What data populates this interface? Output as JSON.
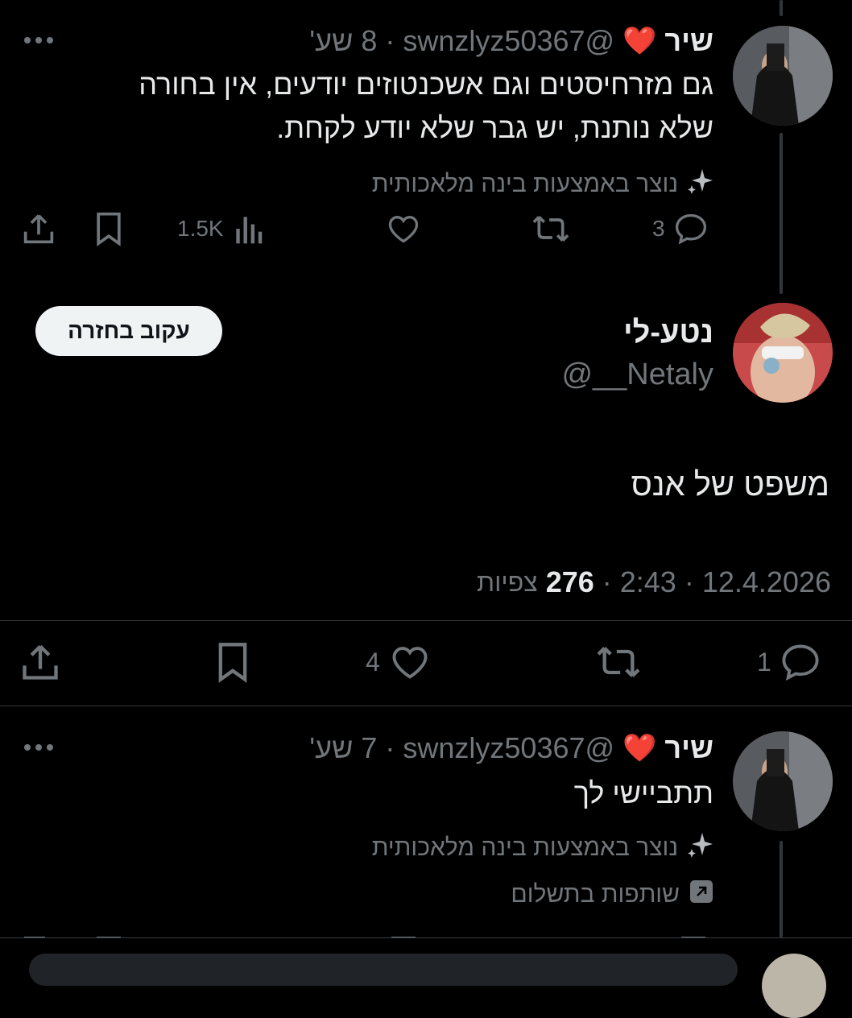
{
  "colors": {
    "background": "#000000",
    "text": "#e7e9ea",
    "muted": "#71767b",
    "heart": "#e8202a"
  },
  "reply1": {
    "name": "שיר",
    "name_emoji": "❤️",
    "handle": "@swnzlyz50367",
    "time": "8 שע'",
    "separator": "·",
    "line1": "גם מזרחיסטים וגם אשכנטוזים יודעים, אין בחורה",
    "line2": "שלא נותנת, יש גבר שלא יודע לקחת.",
    "ai_label": "נוצר באמצעות בינה מלאכותית",
    "replies": "3",
    "views": "1.5K"
  },
  "main_post": {
    "name": "נטע-לי",
    "handle": "@__Netaly",
    "follow_label": "עקוב בחזרה",
    "text": "משפט של אנס",
    "date": "12.4.2026",
    "time": "2:43",
    "views_count": "276",
    "views_label": "צפיות",
    "separator": "·",
    "replies": "1",
    "likes": "4"
  },
  "reply2": {
    "name": "שיר",
    "name_emoji": "❤️",
    "handle": "@swnzlyz50367",
    "time": "7 שע'",
    "separator": "·",
    "text": "תתביישי לך",
    "ai_label": "נוצר באמצעות בינה מלאכותית",
    "paid_label": "שותפות בתשלום"
  },
  "icons": [
    "more-icon",
    "sparkle-icon",
    "reply-icon",
    "retweet-icon",
    "like-icon",
    "views-icon",
    "bookmark-icon",
    "share-icon",
    "paid-partnership-icon"
  ]
}
